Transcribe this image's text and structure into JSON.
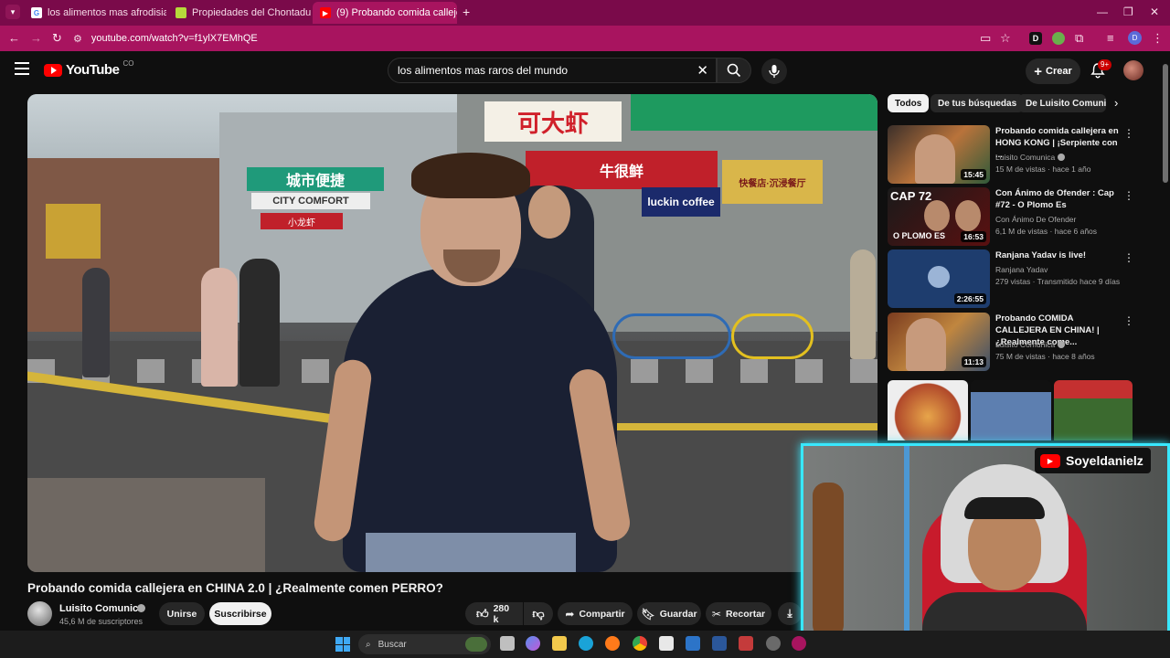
{
  "browser": {
    "tabs": [
      {
        "title": "los alimentos mas afrodisiacos",
        "active": false
      },
      {
        "title": "Propiedades del Chontaduro e",
        "active": false
      },
      {
        "title": "(9) Probando comida calleje",
        "active": true
      }
    ],
    "url": "youtube.com/watch?v=f1ylX7EMhQE",
    "profile_letter": "D",
    "extension_letter": "D",
    "theme_color": "#a8145f"
  },
  "header": {
    "logo_text": "YouTube",
    "country_code": "CO",
    "search_value": "los alimentos mas raros del mundo",
    "create_label": "Crear",
    "notifications_badge": "9+"
  },
  "video": {
    "title": "Probando comida callejera en CHINA 2.0 | ¿Realmente comen PERRO?",
    "scene_signs": [
      "可大虾",
      "城市便捷",
      "CITY COMFORT",
      "牛很鲜",
      "luckin coffee",
      "小龙虾",
      "快餐店·沉浸餐厅"
    ],
    "channel": {
      "name": "Luisito Comunica",
      "subscribers": "45,6 M de suscriptores"
    },
    "join_label": "Unirse",
    "subscribe_label": "Suscribirse",
    "likes": "280 k",
    "share_label": "Compartir",
    "save_label": "Guardar",
    "clip_label": "Recortar"
  },
  "sidebar": {
    "chips": [
      "Todos",
      "De tus búsquedas",
      "De Luisito Comunic"
    ],
    "recommendations": [
      {
        "title": "Probando comida callejera en HONG KONG | ¡Serpiente con ...",
        "channel": "Luisito Comunica",
        "verified": true,
        "meta": "15 M de vistas · hace 1 año",
        "duration": "15:45"
      },
      {
        "title": "Con Ánimo de Ofender : Cap #72 - O Plomo Es",
        "channel": "Con Ánimo De Ofender",
        "verified": false,
        "meta": "6,1 M de vistas · hace 6 años",
        "duration": "16:53",
        "thumb_text": "O PLOMO ES",
        "thumb_cap": "CAP 72"
      },
      {
        "title": "Ranjana Yadav is live!",
        "channel": "Ranjana Yadav",
        "verified": false,
        "meta": "279 vistas · Transmitido hace 9 días",
        "duration": "2:26:55"
      },
      {
        "title": "Probando COMIDA CALLEJERA EN CHINA! | ¿Realmente come...",
        "channel": "Luisito Comunica",
        "verified": true,
        "meta": "75 M de vistas · hace 8 años",
        "duration": "11:13"
      }
    ]
  },
  "overlay": {
    "streamer_name": "Soyeldanielz"
  },
  "taskbar": {
    "search_placeholder": "Buscar"
  }
}
